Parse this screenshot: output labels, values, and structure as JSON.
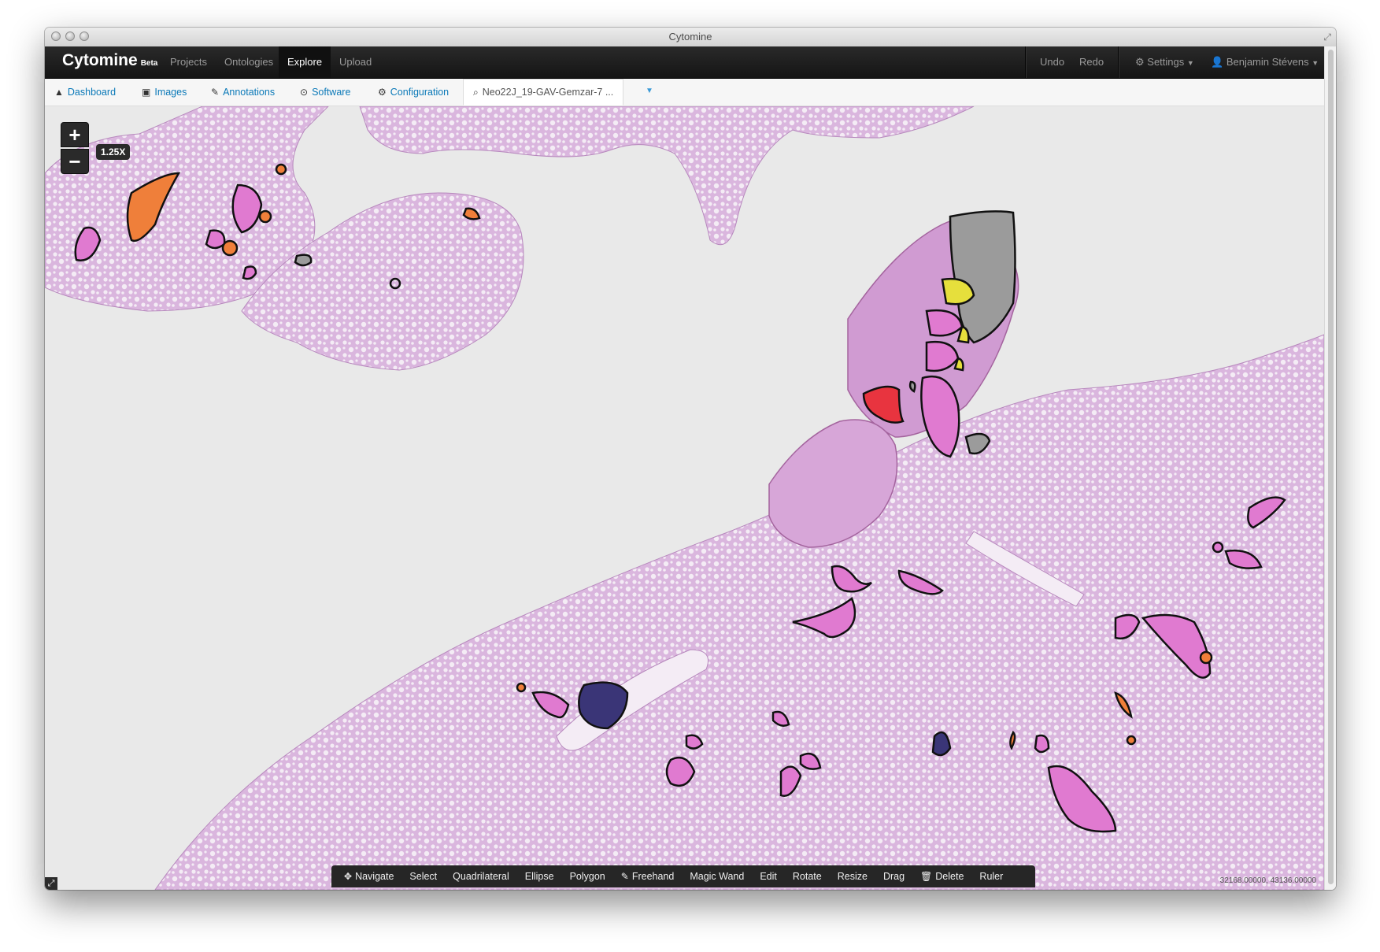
{
  "window": {
    "title": "Cytomine"
  },
  "navbar": {
    "brand": "Cytomine",
    "brand_badge": "Beta",
    "items": [
      "Projects",
      "Ontologies",
      "Explore",
      "Upload"
    ],
    "active": "Explore",
    "undo": "Undo",
    "redo": "Redo",
    "settings": "Settings",
    "user": "Benjamin Stévens"
  },
  "tabs": {
    "dashboard": "Dashboard",
    "images": "Images",
    "annotations": "Annotations",
    "software": "Software",
    "configuration": "Configuration",
    "image_tab": "Neo22J_19-GAV-Gemzar-7 ..."
  },
  "viewer": {
    "zoom_in": "+",
    "zoom_out": "−",
    "zoom_level": "1.25X",
    "coordinates": "32168.00000, 43136.00000"
  },
  "toolbar": {
    "tools": [
      "Navigate",
      "Select",
      "Quadrilateral",
      "Ellipse",
      "Polygon",
      "Freehand",
      "Magic Wand",
      "Edit",
      "Rotate",
      "Resize",
      "Drag",
      "Delete",
      "Ruler"
    ]
  },
  "colors": {
    "tissue": "#d9b4dd",
    "annotation_pink": "#e07ad0",
    "annotation_orange": "#ef7f3a",
    "annotation_yellow": "#e6df3c",
    "annotation_red": "#e8343f",
    "annotation_grey": "#9b9b9b",
    "annotation_navy": "#3a3577",
    "link": "#0b79b8"
  }
}
